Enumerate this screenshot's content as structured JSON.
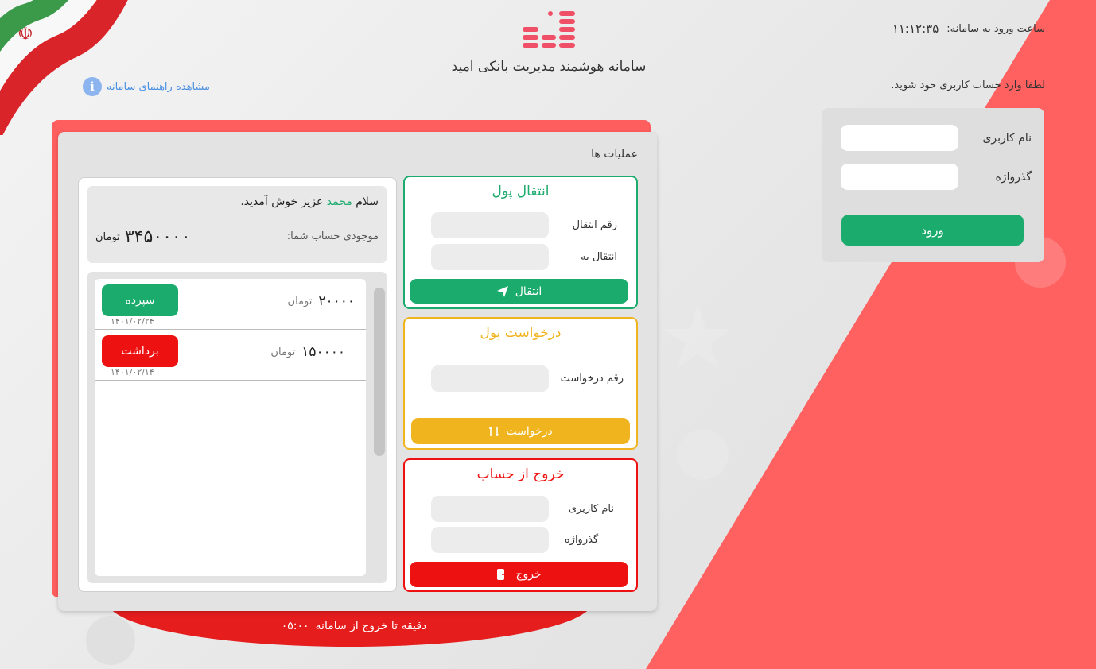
{
  "app": {
    "title": "سامانه هوشمند مدیریت بانکی امید",
    "login_time_label": "ساعت ورود به سامانه:",
    "login_time_value": "۱۱:۱۲:۳۵",
    "guide_link": "مشاهده راهنمای سامانه",
    "login_hint": "لطفا وارد حساب کاربری خود شوید."
  },
  "login": {
    "username_label": "نام کاربری",
    "password_label": "گذرواژه",
    "username_value": "",
    "password_value": "",
    "submit_label": "ورود"
  },
  "operations": {
    "title": "عملیات ها",
    "transfer": {
      "title": "انتقال پول",
      "amount_label": "رقم انتقال",
      "to_label": "انتقال به",
      "button_label": "انتقال",
      "color": "#1bab6d"
    },
    "request": {
      "title": "درخواست پول",
      "amount_label": "رقم درخواست",
      "button_label": "درخواست",
      "color": "#f0b41e"
    },
    "logout": {
      "title": "خروج از حساب",
      "username_label": "نام کاربری",
      "password_label": "گذرواژه",
      "button_label": "خروج",
      "color": "#ee1111"
    }
  },
  "account": {
    "greeting_prefix": "سلام",
    "user_name": "محمد",
    "greeting_suffix": "عزیز خوش آمدید.",
    "balance_label": "موجودی حساب شما:",
    "balance_value": "۳۴۵۰۰۰۰",
    "currency": "تومان"
  },
  "transactions": [
    {
      "type": "سپرده",
      "amount": "۲۰۰۰۰",
      "currency": "تومان",
      "date": "۱۴۰۱/۰۲/۲۴",
      "color": "#1bab6d"
    },
    {
      "type": "برداشت",
      "amount": "۱۵۰۰۰۰",
      "currency": "تومان",
      "date": "۱۴۰۱/۰۲/۱۴",
      "color": "#ee1111"
    }
  ],
  "session": {
    "remaining": "۰۵:۰۰",
    "remaining_label": "دقیقه تا خروج از سامانه"
  }
}
